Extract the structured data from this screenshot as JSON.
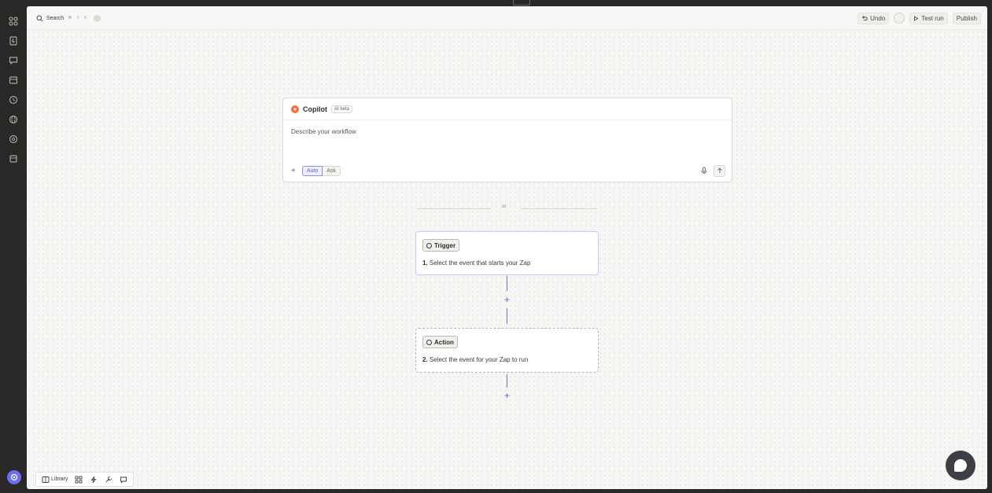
{
  "topbar": {
    "search_label": "Search",
    "undo_label": "Undo",
    "test_run_label": "Test run",
    "publish_label": "Publish"
  },
  "copilot": {
    "title": "Copilot",
    "badge": "AI beta",
    "prompt_placeholder": "Describe your workflow",
    "modes": [
      "Auto",
      "Ask"
    ]
  },
  "divider": {
    "or_text": "or"
  },
  "steps": [
    {
      "pill": "Trigger",
      "number": "1.",
      "text": "Select the event that starts your Zap"
    },
    {
      "pill": "Action",
      "number": "2.",
      "text": "Select the event for your Zap to run"
    }
  ],
  "bottom_toolbar": {
    "library_label": "Library"
  },
  "colors": {
    "accent": "#6a6ef0",
    "copilot_brand": "#ff6b3d",
    "canvas": "#f7f6f4",
    "rail": "#2a2826"
  },
  "icons": {
    "rail": [
      "apps-icon",
      "zap-icon",
      "chat-icon",
      "table-icon",
      "clock-icon",
      "globe-icon",
      "gear-icon",
      "archive-icon"
    ]
  }
}
